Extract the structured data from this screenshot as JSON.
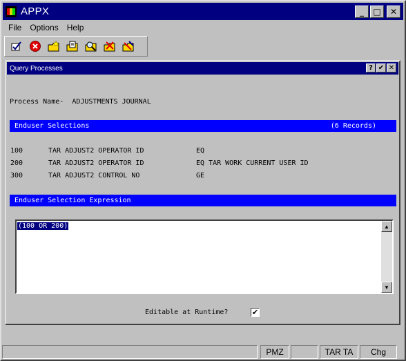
{
  "window": {
    "title": "APPX",
    "buttons": {
      "minimize": "_",
      "maximize": "□",
      "close": "✕"
    }
  },
  "menu": [
    "File",
    "Options",
    "Help"
  ],
  "toolbar": [
    "ok-check-icon",
    "cancel-icon",
    "folder-new-icon",
    "folder-edit-icon",
    "folder-search-icon",
    "folder-delete-icon",
    "folder-edit-check-icon"
  ],
  "child": {
    "title": "Query Processes",
    "buttons": {
      "help": "?",
      "ok": "✔",
      "close": "✕"
    }
  },
  "process": {
    "label": "Process Name-",
    "value": "ADJUSTMENTS JOURNAL"
  },
  "selections": {
    "header": "Enduser Selections",
    "count": "(6 Records)",
    "rows": [
      {
        "num": "100",
        "field": "TAR ADJUST2 OPERATOR ID",
        "op": "EQ"
      },
      {
        "num": "200",
        "field": "TAR ADJUST2 OPERATOR ID",
        "op": "EQ TAR WORK CURRENT USER ID"
      },
      {
        "num": "300",
        "field": "TAR ADJUST2 CONTROL NO",
        "op": "GE"
      }
    ]
  },
  "expression": {
    "header": "Enduser Selection Expression",
    "value": "(100 OR 200)"
  },
  "editable": {
    "label": "Editable at Runtime?",
    "checked": true,
    "mark": "✔"
  },
  "status": {
    "segments": [
      "",
      "",
      "PMZ",
      "",
      "TAR TA",
      "Chg"
    ]
  }
}
